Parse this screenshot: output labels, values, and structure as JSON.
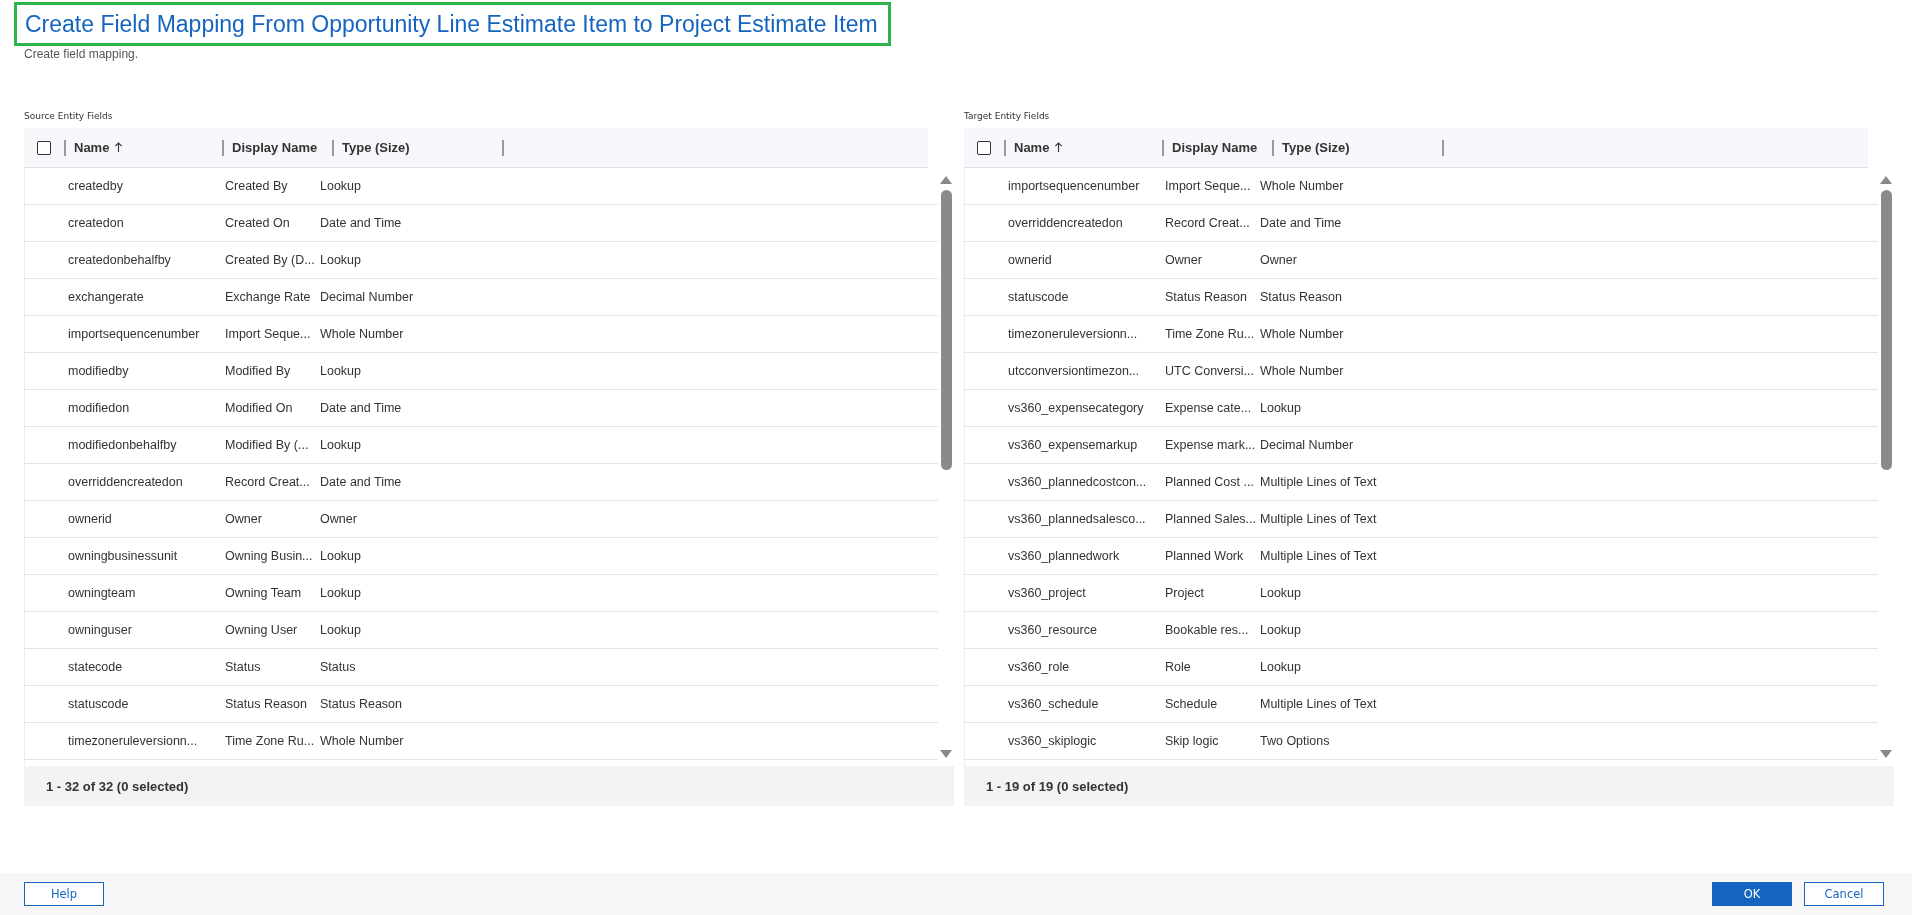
{
  "title": "Create Field Mapping From Opportunity Line Estimate Item to Project Estimate Item",
  "subtitle": "Create field mapping.",
  "grids": [
    {
      "label": "Source Entity Fields",
      "select_all": {
        "checked": false
      },
      "columns": [
        "Name",
        "Display Name",
        "Type (Size)"
      ],
      "footer": "1 - 32 of 32 (0 selected)",
      "rows": [
        [
          "createdby",
          "Created By",
          "Lookup"
        ],
        [
          "createdon",
          "Created On",
          "Date and Time"
        ],
        [
          "createdonbehalfby",
          "Created By (D...",
          "Lookup"
        ],
        [
          "exchangerate",
          "Exchange Rate",
          "Decimal Number"
        ],
        [
          "importsequencenumber",
          "Import Seque...",
          "Whole Number"
        ],
        [
          "modifiedby",
          "Modified By",
          "Lookup"
        ],
        [
          "modifiedon",
          "Modified On",
          "Date and Time"
        ],
        [
          "modifiedonbehalfby",
          "Modified By (...",
          "Lookup"
        ],
        [
          "overriddencreatedon",
          "Record Creat...",
          "Date and Time"
        ],
        [
          "ownerid",
          "Owner",
          "Owner"
        ],
        [
          "owningbusinessunit",
          "Owning Busin...",
          "Lookup"
        ],
        [
          "owningteam",
          "Owning Team",
          "Lookup"
        ],
        [
          "owninguser",
          "Owning User",
          "Lookup"
        ],
        [
          "statecode",
          "Status",
          "Status"
        ],
        [
          "statuscode",
          "Status Reason",
          "Status Reason"
        ],
        [
          "timezoneruleversionn...",
          "Time Zone Ru...",
          "Whole Number"
        ]
      ]
    },
    {
      "label": "Target Entity Fields",
      "select_all": {
        "checked": false
      },
      "columns": [
        "Name",
        "Display Name",
        "Type (Size)"
      ],
      "footer": "1 - 19 of 19 (0 selected)",
      "rows": [
        [
          "importsequencenumber",
          "Import Seque...",
          "Whole Number"
        ],
        [
          "overriddencreatedon",
          "Record Creat...",
          "Date and Time"
        ],
        [
          "ownerid",
          "Owner",
          "Owner"
        ],
        [
          "statuscode",
          "Status Reason",
          "Status Reason"
        ],
        [
          "timezoneruleversionn...",
          "Time Zone Ru...",
          "Whole Number"
        ],
        [
          "utcconversiontimezon...",
          "UTC Conversi...",
          "Whole Number"
        ],
        [
          "vs360_expensecategory",
          "Expense cate...",
          "Lookup"
        ],
        [
          "vs360_expensemarkup",
          "Expense mark...",
          "Decimal Number"
        ],
        [
          "vs360_plannedcostcon...",
          "Planned Cost ...",
          "Multiple Lines of Text"
        ],
        [
          "vs360_plannedsalesco...",
          "Planned Sales...",
          "Multiple Lines of Text"
        ],
        [
          "vs360_plannedwork",
          "Planned Work",
          "Multiple Lines of Text"
        ],
        [
          "vs360_project",
          "Project",
          "Lookup"
        ],
        [
          "vs360_resource",
          "Bookable res...",
          "Lookup"
        ],
        [
          "vs360_role",
          "Role",
          "Lookup"
        ],
        [
          "vs360_schedule",
          "Schedule",
          "Multiple Lines of Text"
        ],
        [
          "vs360_skiplogic",
          "Skip logic",
          "Two Options"
        ]
      ]
    }
  ],
  "buttons": {
    "help": "Help",
    "ok": "OK",
    "cancel": "Cancel"
  }
}
